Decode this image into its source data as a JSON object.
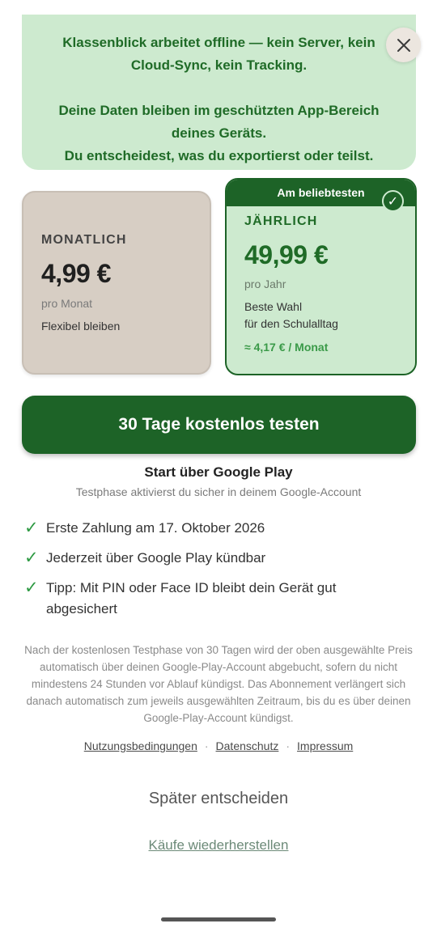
{
  "privacy": {
    "line1": "Klassenblick arbeitet offline — kein Server, kein Cloud-Sync, kein Tracking.",
    "line2": "Deine Daten bleiben im geschützten App-Bereich deines Geräts.",
    "line3": "Du entscheidest, was du exportierst oder teilst."
  },
  "close_icon": "close-icon",
  "plans": {
    "monthly": {
      "label": "MONATLICH",
      "price": "4,99 €",
      "period": "pro Monat",
      "description": "Flexibel bleiben"
    },
    "yearly": {
      "badge": "Am beliebtesten",
      "check": "✓",
      "label": "JÄHRLICH",
      "price": "49,99 €",
      "period": "pro Jahr",
      "description_line1": "Beste Wahl",
      "description_line2": "für den Schulalltag",
      "monthly_equivalent": "≈ 4,17 € / Monat"
    }
  },
  "cta": {
    "label": "30 Tage kostenlos testen"
  },
  "start": {
    "title": "Start über Google Play",
    "subtitle": "Testphase aktivierst du sicher in deinem Google-Account"
  },
  "benefits": [
    {
      "check": "✓",
      "text": "Erste Zahlung am 17. Oktober 2026"
    },
    {
      "check": "✓",
      "text": "Jederzeit über Google Play kündbar"
    },
    {
      "check": "✓",
      "text": "Tipp: Mit PIN oder Face ID bleibt dein Gerät gut abgesichert"
    }
  ],
  "legal": "Nach der kostenlosen Testphase von 30 Tagen wird der oben ausgewählte Preis automatisch über deinen Google-Play-Account abgebucht, sofern du nicht mindestens 24 Stunden vor Ablauf kündigst. Das Abonnement verlängert sich danach automatisch zum jeweils ausgewählten Zeitraum, bis du es über deinen Google-Play-Account kündigst.",
  "links": {
    "terms": "Nutzungsbedingungen",
    "separator": "·",
    "privacy": "Datenschutz",
    "imprint": "Impressum"
  },
  "later": "Später entscheiden",
  "restore": "Käufe wiederherstellen",
  "colors": {
    "brand_green": "#1d6327",
    "light_green": "#cdeacf",
    "beige": "#d7cec4",
    "check_green": "#2e9a43"
  }
}
